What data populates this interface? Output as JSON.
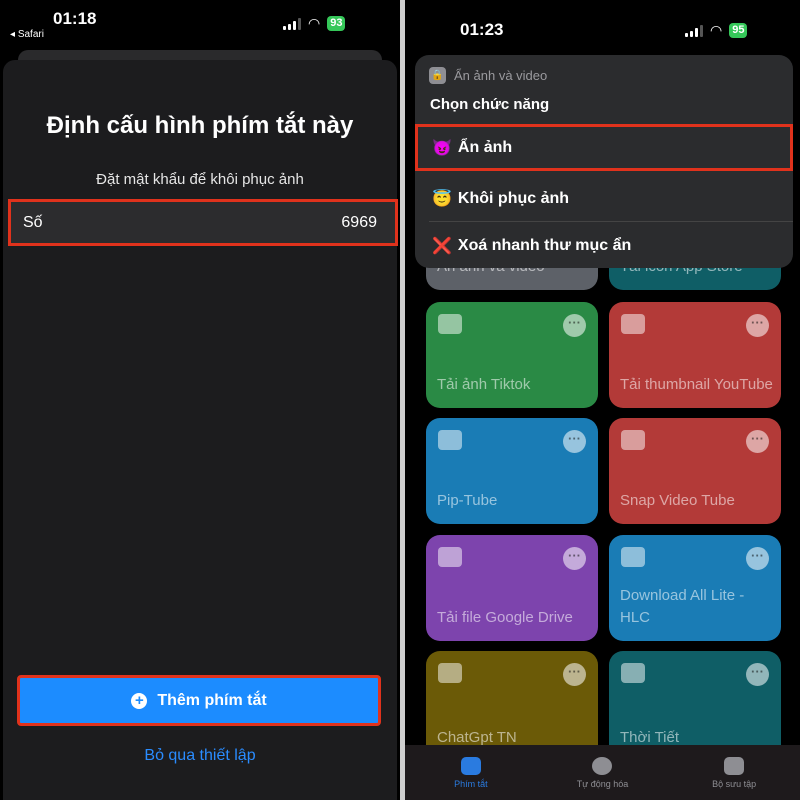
{
  "left": {
    "status": {
      "time": "01:18",
      "back_app": "Safari",
      "battery": "93"
    },
    "title": "Định cấu hình phím tắt này",
    "subtitle": "Đặt mật khẩu để khôi phục ảnh",
    "field": {
      "label": "Số",
      "value": "6969"
    },
    "add_button": "Thêm phím tắt",
    "skip_link": "Bỏ qua thiết lập",
    "accent": "#1c8cff",
    "highlight": "#e0321c"
  },
  "right": {
    "status": {
      "time": "01:23",
      "battery": "95"
    },
    "menu": {
      "shortcut_name": "Ẩn ảnh và video",
      "prompt": "Chọn chức năng",
      "items": [
        {
          "emoji": "😈",
          "label": "Ẩn ảnh",
          "selected": true
        },
        {
          "emoji": "😇",
          "label": "Khôi phục ảnh"
        },
        {
          "emoji": "❌",
          "label": "Xoá nhanh thư mục ẩn"
        }
      ]
    },
    "tiles": [
      {
        "label": "Ẩn ảnh và video",
        "color": "#5d6168"
      },
      {
        "label": "Tải icon App Store",
        "color": "#0f5e66"
      },
      {
        "label": "Tải ảnh Tiktok",
        "color": "#2a8a45",
        "icon": "download-icon"
      },
      {
        "label": "Tải thumbnail YouTube",
        "color": "#b33a38",
        "icon": "play-icon"
      },
      {
        "label": "Pip-Tube",
        "color": "#1a7cb5",
        "icon": "play-icon"
      },
      {
        "label": "Snap Video Tube",
        "color": "#b33a38",
        "icon": "play-icon"
      },
      {
        "label": "Tải file Google Drive",
        "color": "#7d44ad",
        "icon": "download-icon"
      },
      {
        "label": "Download All Lite - HLC",
        "color": "#1a7cb5",
        "icon": "download-icon"
      },
      {
        "label": "ChatGpt TN",
        "color": "#6b5a07",
        "icon": "hand-icon"
      },
      {
        "label": "Thời Tiết",
        "color": "#0f5e66",
        "icon": "layers-icon"
      }
    ],
    "tabs": [
      {
        "label": "Phím tắt",
        "active": true
      },
      {
        "label": "Tự động hóa"
      },
      {
        "label": "Bộ sưu tập"
      }
    ]
  }
}
